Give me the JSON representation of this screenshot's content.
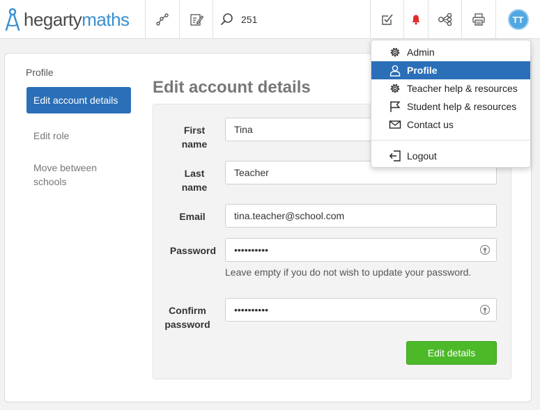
{
  "brand": {
    "part1": "hegarty",
    "part2": "maths"
  },
  "search": {
    "value": "251"
  },
  "avatar": {
    "initials": "TT"
  },
  "sidebar": {
    "title": "Profile",
    "items": [
      {
        "label": "Edit account details"
      },
      {
        "label": "Edit role"
      },
      {
        "label": "Move between schools"
      }
    ]
  },
  "page": {
    "title": "Edit account details"
  },
  "form": {
    "first_name": {
      "label": "First name",
      "value": "Tina"
    },
    "last_name": {
      "label": "Last name",
      "value": "Teacher"
    },
    "email": {
      "label": "Email",
      "value": "tina.teacher@school.com"
    },
    "password": {
      "label": "Password",
      "value": "••••••••••"
    },
    "password_hint": "Leave empty if you do not wish to update your password.",
    "confirm": {
      "label": "Confirm password",
      "value": "••••••••••"
    },
    "submit": "Edit details"
  },
  "menu": {
    "items": [
      {
        "label": "Admin",
        "icon": "gear-icon"
      },
      {
        "label": "Profile",
        "icon": "user-icon"
      },
      {
        "label": "Teacher help & resources",
        "icon": "gear-icon"
      },
      {
        "label": "Student help & resources",
        "icon": "flag-icon"
      },
      {
        "label": "Contact us",
        "icon": "envelope-icon"
      }
    ],
    "logout": {
      "label": "Logout",
      "icon": "logout-icon"
    }
  },
  "colors": {
    "accent": "#2a6fb8",
    "brand_blue": "#3a8fd0",
    "success": "#4cb928",
    "alert": "#e02b2b"
  }
}
